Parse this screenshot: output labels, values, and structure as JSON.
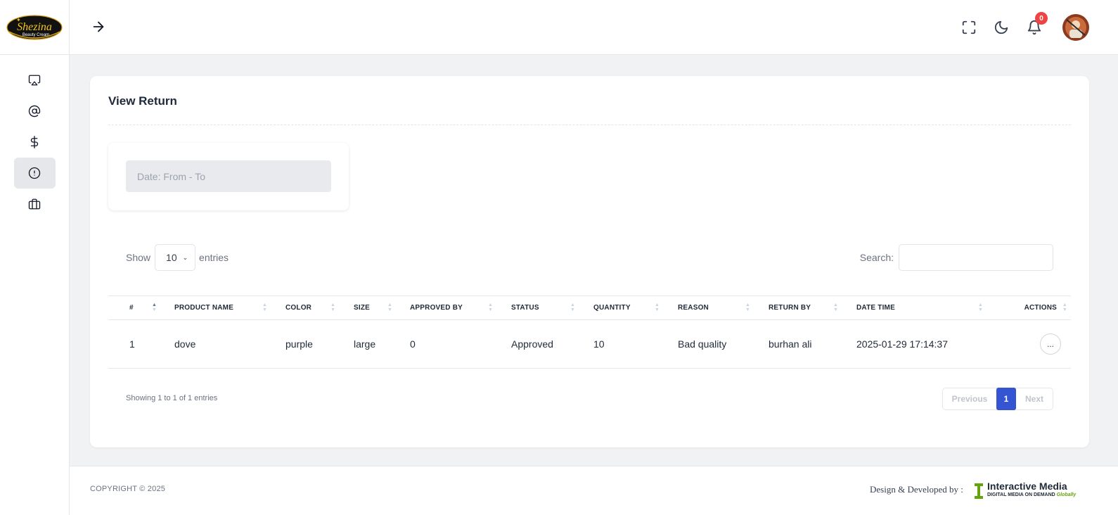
{
  "brand": {
    "name": "Shezina",
    "tagline": "Beauty Cream"
  },
  "sidebar": {
    "items": [
      {
        "icon": "airplay-icon",
        "active": false
      },
      {
        "icon": "at-sign-icon",
        "active": false
      },
      {
        "icon": "dollar-icon",
        "active": false
      },
      {
        "icon": "alert-circle-icon",
        "active": true
      },
      {
        "icon": "briefcase-icon",
        "active": false
      }
    ]
  },
  "header": {
    "notification_count": "0"
  },
  "page": {
    "title": "View Return",
    "date_placeholder": "Date: From - To"
  },
  "table_controls": {
    "show_label": "Show",
    "entries_value": "10",
    "entries_label": "entries",
    "search_label": "Search:",
    "search_value": ""
  },
  "table": {
    "columns": [
      "#",
      "PRODUCT NAME",
      "COLOR",
      "SIZE",
      "APPROVED BY",
      "STATUS",
      "QUANTITY",
      "REASON",
      "RETURN BY",
      "DATE TIME",
      "ACTIONS"
    ],
    "rows": [
      [
        "1",
        "dove",
        "purple",
        "large",
        "0",
        "Approved",
        "10",
        "Bad quality",
        "burhan ali",
        "2025-01-29 17:14:37",
        "..."
      ]
    ]
  },
  "pagination": {
    "info": "Showing 1 to 1 of 1 entries",
    "previous": "Previous",
    "current": "1",
    "next": "Next"
  },
  "footer": {
    "copyright": "COPYRIGHT © 2025",
    "designed_by": "Design & Developed by :",
    "company": "Interactive Media",
    "company_tag": "DIGITAL MEDIA ON DEMAND",
    "company_tag_accent": "Globally"
  },
  "colors": {
    "primary": "#3454d1",
    "badge": "#ef4444",
    "background": "#f1f2f4"
  }
}
